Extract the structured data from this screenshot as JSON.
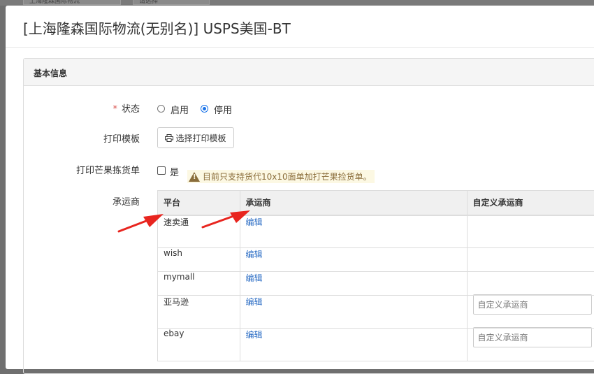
{
  "background": {
    "select1": "上海隆森国际物流",
    "select2": "请选择"
  },
  "modal": {
    "title": "[上海隆森国际物流(无别名)] USPS美国-BT"
  },
  "panel": {
    "heading": "基本信息"
  },
  "form": {
    "status": {
      "label": "状态",
      "required_mark": "*",
      "options": [
        "启用",
        "停用"
      ],
      "selected": "停用"
    },
    "print_template": {
      "label": "打印模板",
      "button_label": "选择打印模板"
    },
    "mango_pick": {
      "label": "打印芒果拣货单",
      "checkbox_label": "是",
      "checked": false,
      "warning": "目前只支持货代10x10面单加打芒果捡货单。"
    },
    "carrier": {
      "label": "承运商"
    }
  },
  "carrier_table": {
    "headers": [
      "平台",
      "承运商",
      "自定义承运商"
    ],
    "rows": [
      {
        "platform": "速卖通",
        "action": "编辑",
        "custom_placeholder": ""
      },
      {
        "platform": "wish",
        "action": "编辑",
        "custom_placeholder": ""
      },
      {
        "platform": "mymall",
        "action": "编辑",
        "custom_placeholder": ""
      },
      {
        "platform": "亚马逊",
        "action": "编辑",
        "custom_placeholder": "自定义承运商"
      },
      {
        "platform": "ebay",
        "action": "编辑",
        "custom_placeholder": "自定义承运商"
      }
    ]
  },
  "colors": {
    "arrow": "#e8251f",
    "link": "#2a6cc4",
    "radio_checked": "#1a73e8",
    "warning_text": "#8a6d3b",
    "warning_bg": "#fcf8e3"
  }
}
